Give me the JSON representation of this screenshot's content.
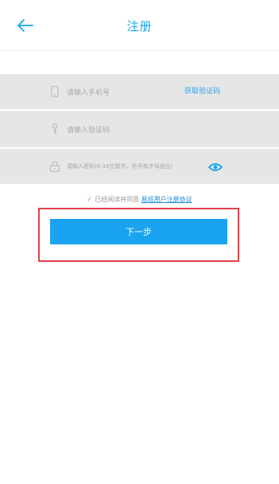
{
  "nav": {
    "title": "注册",
    "back_icon": "arrow-left-icon"
  },
  "form": {
    "phone_placeholder": "请输入手机号",
    "sms_button_label": "获取验证码",
    "code_placeholder": "请输入验证码",
    "password_placeholder": "请输入密码(6-16位数字、符号和字母组合)"
  },
  "agreement": {
    "check_mark": "✓",
    "prefix": "已经阅读并同意",
    "link_text": "易班用户注册协议"
  },
  "actions": {
    "next_label": "下一步"
  },
  "colors": {
    "accent": "#1aa3f0",
    "highlight": "#e0414a",
    "field_bg": "#e6e6e6"
  }
}
